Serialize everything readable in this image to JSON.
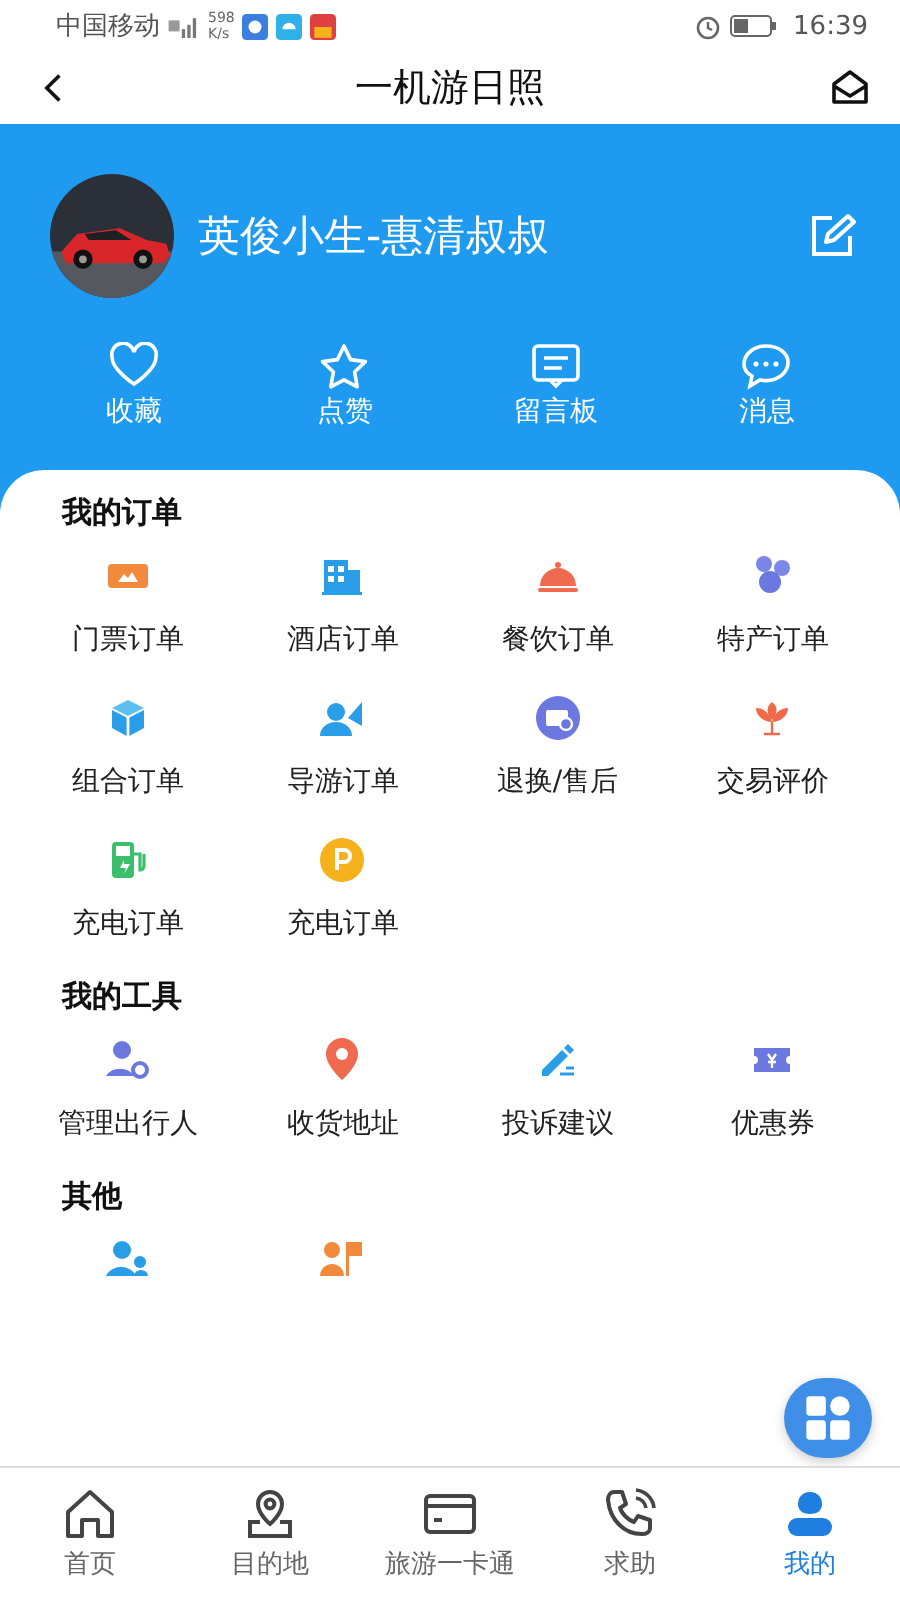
{
  "status_bar": {
    "carrier": "中国移动",
    "speed_value": "598",
    "speed_unit": "K/s",
    "time": "16:39"
  },
  "header": {
    "title": "一机游日照"
  },
  "profile": {
    "name": "英俊小生-惠清叔叔"
  },
  "quick_actions": [
    {
      "label": "收藏"
    },
    {
      "label": "点赞"
    },
    {
      "label": "留言板"
    },
    {
      "label": "消息"
    }
  ],
  "sections": [
    {
      "title": "我的订单",
      "items": [
        {
          "kind": "labeled",
          "label": "门票订单"
        },
        {
          "kind": "labeled",
          "label": "酒店订单"
        },
        {
          "kind": "labeled",
          "label": "餐饮订单"
        },
        {
          "kind": "labeled",
          "label": "特产订单"
        },
        {
          "kind": "labeled",
          "label": "组合订单"
        },
        {
          "kind": "labeled",
          "label": "导游订单"
        },
        {
          "kind": "labeled",
          "label": "退换/售后"
        },
        {
          "kind": "labeled",
          "label": "交易评价"
        },
        {
          "kind": "labeled",
          "label": "充电订单"
        },
        {
          "kind": "labeled",
          "label": "充电订单"
        }
      ]
    },
    {
      "title": "我的工具",
      "items": [
        {
          "kind": "labeled",
          "label": "管理出行人"
        },
        {
          "kind": "labeled",
          "label": "收货地址"
        },
        {
          "kind": "labeled",
          "label": "投诉建议"
        },
        {
          "kind": "labeled",
          "label": "优惠券"
        }
      ]
    },
    {
      "title": "其他",
      "items": [
        {
          "kind": "icon"
        },
        {
          "kind": "icon"
        }
      ]
    }
  ],
  "bottom_nav": [
    {
      "label": "首页",
      "selected": false
    },
    {
      "label": "目的地",
      "selected": false
    },
    {
      "label": "旅游一卡通",
      "selected": false
    },
    {
      "label": "求助",
      "selected": false
    },
    {
      "label": "我的",
      "selected": true
    }
  ]
}
